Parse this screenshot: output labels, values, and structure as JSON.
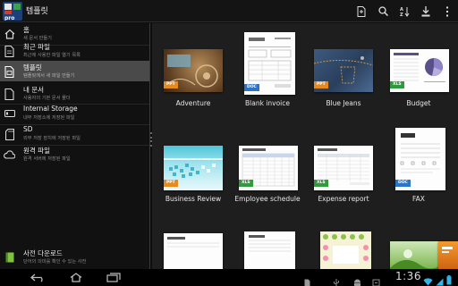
{
  "app": {
    "title": "템플릿"
  },
  "colors": {
    "accent_orange": "#f7a21b",
    "badge_pdf": "#e7891c",
    "badge_doc": "#2a74c9",
    "badge_xls": "#2f9b3c",
    "selected_row": "#4a4a4a"
  },
  "actionbar": {
    "icons": [
      "new-document-icon",
      "search-icon",
      "sort-az-icon",
      "download-icon",
      "overflow-menu-icon"
    ],
    "sort_label": "A Z"
  },
  "sidebar": {
    "items": [
      {
        "title": "홈",
        "subtitle": "새 문서 만들기",
        "icon": "home-icon"
      },
      {
        "title": "최근 파일",
        "subtitle": "최근에 사용한 파일 열기 목록",
        "icon": "recent-files-icon"
      },
      {
        "title": "템플릿",
        "subtitle": "템플릿에서 새 파일 만들기",
        "icon": "template-icon",
        "selected": true
      },
      {
        "title": "내 문서",
        "subtitle": "사용자의 기본 문서 폴더",
        "icon": "my-documents-icon"
      },
      {
        "title": "Internal Storage",
        "subtitle": "내부 저장소에 저장된 파일",
        "icon": "internal-storage-icon"
      },
      {
        "title": "SD",
        "subtitle": "외부 저장 장치에 저장된 파일",
        "icon": "sd-card-icon"
      },
      {
        "title": "원격 파일",
        "subtitle": "원격 서버에 저장된 파일",
        "icon": "cloud-icon"
      }
    ],
    "bottom": {
      "title": "사전 다운로드",
      "subtitle": "단어의 의미를 확인 수 있는 사전",
      "icon": "dictionary-download-icon"
    }
  },
  "templates": [
    {
      "name": "Adventure",
      "type": "PPT"
    },
    {
      "name": "Blank invoice",
      "type": "DOC"
    },
    {
      "name": "Blue Jeans",
      "type": "PPT"
    },
    {
      "name": "Budget",
      "type": "XLS"
    },
    {
      "name": "Business Review",
      "type": "PPT"
    },
    {
      "name": "Employee schedule",
      "type": "XLS"
    },
    {
      "name": "Expense report",
      "type": "XLS"
    },
    {
      "name": "FAX",
      "type": "DOC"
    },
    {
      "name": "",
      "type": ""
    },
    {
      "name": "",
      "type": ""
    },
    {
      "name": "",
      "type": ""
    },
    {
      "name": "",
      "type": ""
    }
  ],
  "sysbar": {
    "time": "1:36",
    "icons": [
      "back-icon",
      "home-nav-icon",
      "recents-icon",
      "file-icon",
      "usb-icon",
      "android-icon",
      "wifi-icon",
      "signal-icon",
      "battery-icon"
    ]
  }
}
